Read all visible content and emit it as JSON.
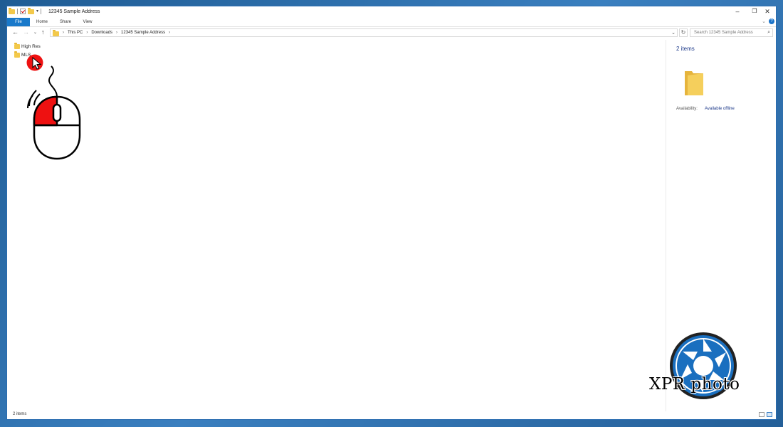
{
  "window": {
    "title": "12345 Sample Address"
  },
  "ribbon": {
    "tabs": [
      "File",
      "Home",
      "Share",
      "View"
    ]
  },
  "nav": {
    "breadcrumb": [
      "This PC",
      "Downloads",
      "12345 Sample Address"
    ],
    "search_placeholder": "Search 12345 Sample Address"
  },
  "files": [
    {
      "name": "High Res"
    },
    {
      "name": "MLS"
    }
  ],
  "details": {
    "count": "2 items",
    "availability_label": "Availability:",
    "availability_value": "Available offline"
  },
  "status": {
    "text": "2 items"
  },
  "watermark": {
    "text": "XPR photo"
  },
  "colors": {
    "accent": "#1979ca",
    "folder": "#f3c94b",
    "highlight": "#ee1111",
    "logo_blue": "#1a6fbf"
  },
  "icons": [
    "folder-icon",
    "mouse-icon",
    "cursor-icon",
    "logo-icon",
    "minimize-icon",
    "maximize-icon",
    "close-icon",
    "search-icon",
    "refresh-icon",
    "help-icon"
  ]
}
